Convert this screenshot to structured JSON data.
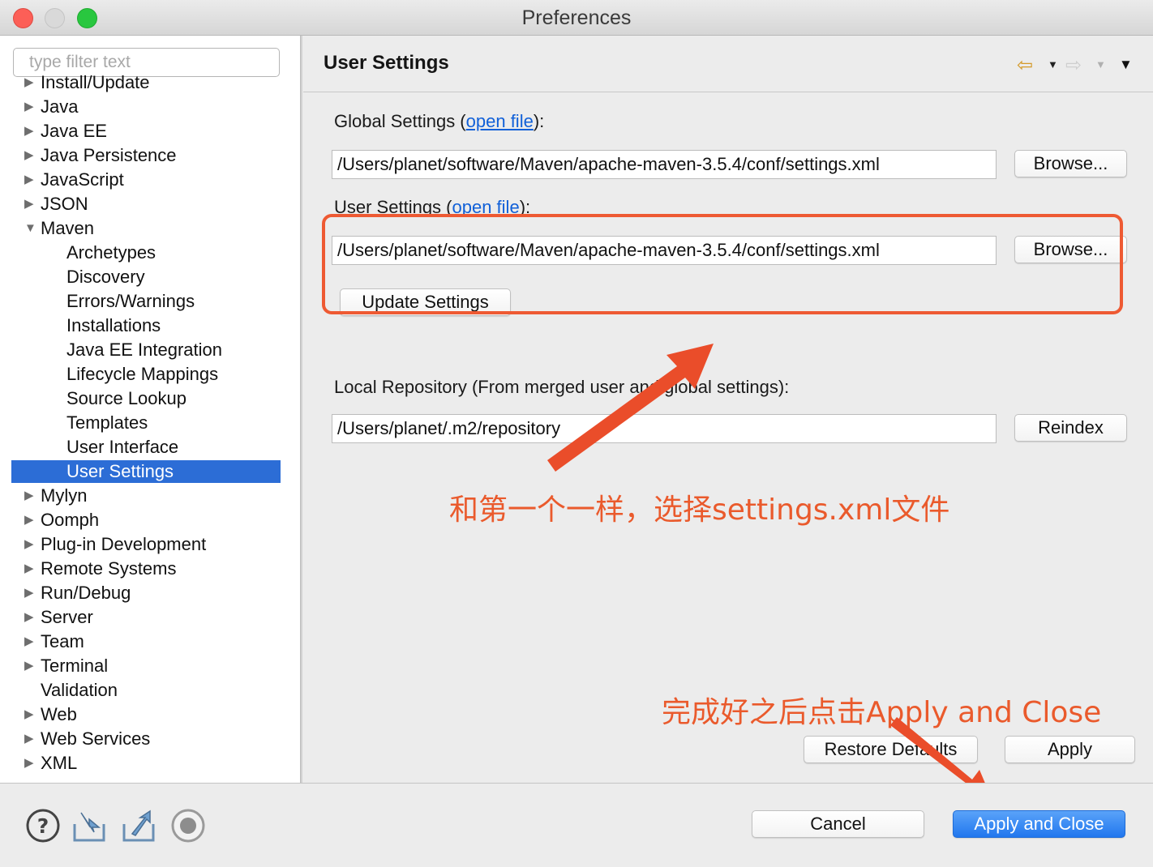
{
  "window": {
    "title": "Preferences"
  },
  "filter": {
    "placeholder": "type filter text"
  },
  "tree": {
    "items": [
      {
        "label": "Install/Update",
        "expanded": false,
        "child": false
      },
      {
        "label": "Java",
        "expanded": false,
        "child": false
      },
      {
        "label": "Java EE",
        "expanded": false,
        "child": false
      },
      {
        "label": "Java Persistence",
        "expanded": false,
        "child": false
      },
      {
        "label": "JavaScript",
        "expanded": false,
        "child": false
      },
      {
        "label": "JSON",
        "expanded": false,
        "child": false
      },
      {
        "label": "Maven",
        "expanded": true,
        "child": false
      },
      {
        "label": "Archetypes",
        "child": true
      },
      {
        "label": "Discovery",
        "child": true
      },
      {
        "label": "Errors/Warnings",
        "child": true
      },
      {
        "label": "Installations",
        "child": true
      },
      {
        "label": "Java EE Integration",
        "child": true
      },
      {
        "label": "Lifecycle Mappings",
        "child": true
      },
      {
        "label": "Source Lookup",
        "child": true
      },
      {
        "label": "Templates",
        "child": true
      },
      {
        "label": "User Interface",
        "child": true
      },
      {
        "label": "User Settings",
        "child": true,
        "selected": true
      },
      {
        "label": "Mylyn",
        "expanded": false,
        "child": false
      },
      {
        "label": "Oomph",
        "expanded": false,
        "child": false
      },
      {
        "label": "Plug-in Development",
        "expanded": false,
        "child": false
      },
      {
        "label": "Remote Systems",
        "expanded": false,
        "child": false
      },
      {
        "label": "Run/Debug",
        "expanded": false,
        "child": false
      },
      {
        "label": "Server",
        "expanded": false,
        "child": false
      },
      {
        "label": "Team",
        "expanded": false,
        "child": false
      },
      {
        "label": "Terminal",
        "expanded": false,
        "child": false
      },
      {
        "label": "Validation",
        "leaf": true,
        "child": false
      },
      {
        "label": "Web",
        "expanded": false,
        "child": false
      },
      {
        "label": "Web Services",
        "expanded": false,
        "child": false
      },
      {
        "label": "XML",
        "expanded": false,
        "child": false
      }
    ]
  },
  "header": {
    "title": "User Settings",
    "icons": [
      "back-arrow-icon",
      "forward-arrow-icon",
      "view-menu-icon"
    ]
  },
  "global": {
    "label_prefix": "Global Settings (",
    "link": "open file",
    "label_suffix": "):",
    "value": "/Users/planet/software/Maven/apache-maven-3.5.4/conf/settings.xml",
    "browse": "Browse..."
  },
  "user": {
    "label_prefix": "User Settings (",
    "link": "open file",
    "label_suffix": "):",
    "value": "/Users/planet/software/Maven/apache-maven-3.5.4/conf/settings.xml",
    "browse": "Browse...",
    "update": "Update Settings"
  },
  "local": {
    "label": "Local Repository (From merged user and global settings):",
    "value": "/Users/planet/.m2/repository",
    "reindex": "Reindex"
  },
  "annotations": {
    "middle": "和第一个一样，选择settings.xml文件",
    "bottom": "完成好之后点击Apply and Close",
    "color": "#ea5a2c"
  },
  "buttons": {
    "restore": "Restore Defaults",
    "apply": "Apply",
    "cancel": "Cancel",
    "apply_close": "Apply and Close"
  },
  "footer": {
    "icons": [
      "help-icon",
      "import-icon",
      "export-icon",
      "record-icon"
    ]
  },
  "colors": {
    "selection": "#2c6dd6",
    "link": "#1160d8",
    "primary_button": "#2177ee"
  }
}
